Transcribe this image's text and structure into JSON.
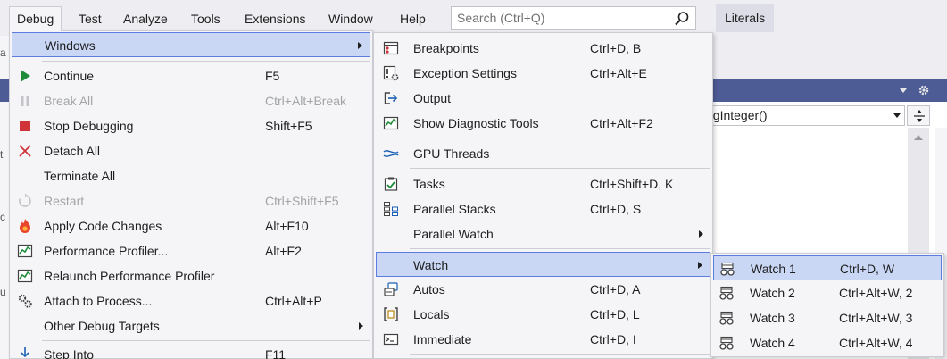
{
  "menubar": {
    "items": [
      {
        "label": "Debug",
        "active": true
      },
      {
        "label": "Test"
      },
      {
        "label": "Analyze"
      },
      {
        "label": "Tools"
      },
      {
        "label": "Extensions"
      },
      {
        "label": "Window"
      },
      {
        "label": "Help"
      }
    ],
    "search_placeholder": "Search (Ctrl+Q)",
    "literals_label": "Literals"
  },
  "editor": {
    "member_combo": "ngInteger()"
  },
  "debug_menu": {
    "items": [
      {
        "label": "Windows",
        "shortcut": "",
        "icon": "none",
        "submenu": true,
        "highlighted": true
      },
      {
        "label": "Continue",
        "shortcut": "F5",
        "icon": "continue-icon"
      },
      {
        "label": "Break All",
        "shortcut": "Ctrl+Alt+Break",
        "icon": "pause-icon",
        "disabled": true
      },
      {
        "label": "Stop Debugging",
        "shortcut": "Shift+F5",
        "icon": "stop-icon"
      },
      {
        "label": "Detach All",
        "shortcut": "",
        "icon": "detach-icon"
      },
      {
        "label": "Terminate All",
        "shortcut": "",
        "icon": "none"
      },
      {
        "label": "Restart",
        "shortcut": "Ctrl+Shift+F5",
        "icon": "restart-icon",
        "disabled": true
      },
      {
        "label": "Apply Code Changes",
        "shortcut": "Alt+F10",
        "icon": "hot-reload-icon"
      },
      {
        "label": "Performance Profiler...",
        "shortcut": "Alt+F2",
        "icon": "profiler-icon"
      },
      {
        "label": "Relaunch Performance Profiler",
        "shortcut": "",
        "icon": "profiler-icon"
      },
      {
        "label": "Attach to Process...",
        "shortcut": "Ctrl+Alt+P",
        "icon": "gears-icon"
      },
      {
        "label": "Other Debug Targets",
        "shortcut": "",
        "icon": "none",
        "submenu": true
      },
      {
        "label": "Step Into",
        "shortcut": "F11",
        "icon": "step-into-icon"
      }
    ]
  },
  "windows_menu": {
    "items": [
      {
        "label": "Breakpoints",
        "shortcut": "Ctrl+D, B",
        "icon": "breakpoints-icon"
      },
      {
        "label": "Exception Settings",
        "shortcut": "Ctrl+Alt+E",
        "icon": "exception-settings-icon"
      },
      {
        "label": "Output",
        "shortcut": "",
        "icon": "output-icon"
      },
      {
        "label": "Show Diagnostic Tools",
        "shortcut": "Ctrl+Alt+F2",
        "icon": "diagnostic-tools-icon"
      },
      {
        "label": "GPU Threads",
        "shortcut": "",
        "icon": "gpu-threads-icon"
      },
      {
        "label": "Tasks",
        "shortcut": "Ctrl+Shift+D, K",
        "icon": "tasks-icon"
      },
      {
        "label": "Parallel Stacks",
        "shortcut": "Ctrl+D, S",
        "icon": "parallel-stacks-icon"
      },
      {
        "label": "Parallel Watch",
        "shortcut": "",
        "icon": "none",
        "submenu": true
      },
      {
        "label": "Watch",
        "shortcut": "",
        "icon": "none",
        "submenu": true,
        "highlighted": true
      },
      {
        "label": "Autos",
        "shortcut": "Ctrl+D, A",
        "icon": "autos-icon"
      },
      {
        "label": "Locals",
        "shortcut": "Ctrl+D, L",
        "icon": "locals-icon"
      },
      {
        "label": "Immediate",
        "shortcut": "Ctrl+D, I",
        "icon": "immediate-icon"
      }
    ]
  },
  "watch_menu": {
    "items": [
      {
        "label": "Watch 1",
        "shortcut": "Ctrl+D, W",
        "icon": "watch-icon",
        "highlighted": true
      },
      {
        "label": "Watch 2",
        "shortcut": "Ctrl+Alt+W, 2",
        "icon": "watch-icon"
      },
      {
        "label": "Watch 3",
        "shortcut": "Ctrl+Alt+W, 3",
        "icon": "watch-icon"
      },
      {
        "label": "Watch 4",
        "shortcut": "Ctrl+Alt+W, 4",
        "icon": "watch-icon"
      }
    ]
  },
  "colors": {
    "menu_bg": "#f5f5f8",
    "highlight_bg": "#c9d7f5",
    "highlight_border": "#5c7ce0",
    "disabled_text": "#a2a4a5",
    "continue_green": "#1e8c3a",
    "stop_red": "#d13438"
  }
}
